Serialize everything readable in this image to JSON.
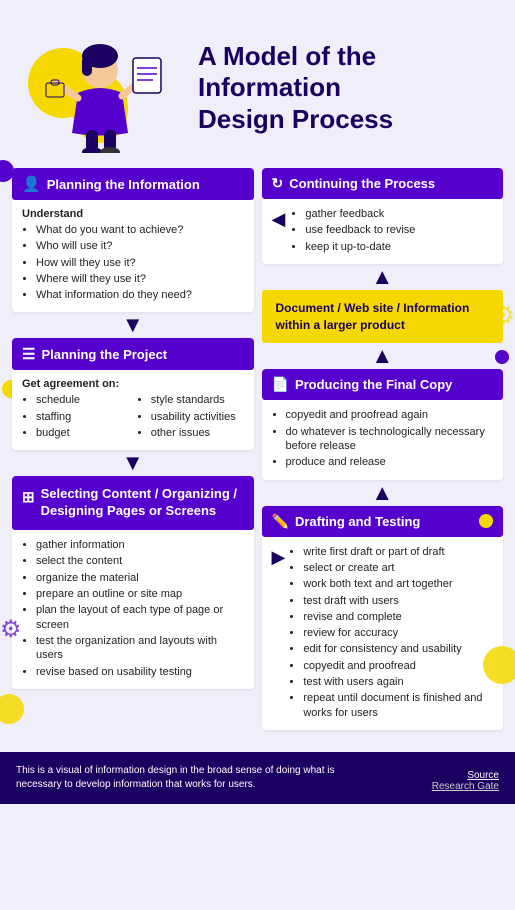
{
  "header": {
    "title_line1": "A Model of the",
    "title_line2": "Information",
    "title_line3": "Design Process"
  },
  "colors": {
    "purple": "#5500cc",
    "dark_purple": "#1a0060",
    "yellow": "#f5d800",
    "bg": "#f0eef8",
    "white": "#ffffff"
  },
  "planning_info": {
    "header": "Planning the Information",
    "understand_label": "Understand",
    "bullets": [
      "What do you want to achieve?",
      "Who will use it?",
      "How will they use it?",
      "Where will they use it?",
      "What information do they need?"
    ]
  },
  "planning_project": {
    "header": "Planning the Project",
    "get_agreement": "Get agreement on:",
    "col1_bullets": [
      "schedule",
      "staffing",
      "budget"
    ],
    "col2_bullets": [
      "style standards",
      "usability activities",
      "other issues"
    ]
  },
  "selecting_content": {
    "header": "Selecting Content / Organizing / Designing Pages or Screens",
    "bullets": [
      "gather information",
      "select the content",
      "organize the material",
      "prepare an outline or site map",
      "plan the layout of each type of page or screen",
      "test the organization and layouts with users",
      "revise based on usability testing"
    ]
  },
  "continuing_process": {
    "header": "Continuing the Process",
    "bullets": [
      "gather feedback",
      "use feedback to revise",
      "keep it up-to-date"
    ]
  },
  "document_box": {
    "text": "Document / Web site / Information within a larger product"
  },
  "producing_final": {
    "header": "Producing the Final Copy",
    "bullets": [
      "copyedit and proofread again",
      "do whatever is technologically necessary before release",
      "produce and release"
    ]
  },
  "drafting_testing": {
    "header": "Drafting and Testing",
    "bullets": [
      "write first draft or part of draft",
      "select or create art",
      "work both text and art together",
      "test draft with users",
      "revise and complete",
      "review for accuracy",
      "edit for consistency and usability",
      "copyedit and proofread",
      "test with users again",
      "repeat until document is finished and works for users"
    ]
  },
  "footer": {
    "description": "This is a visual of information design in the broad sense of doing what is necessary to develop information that works for users.",
    "source_label": "Source",
    "source_name": "Research Gate"
  }
}
